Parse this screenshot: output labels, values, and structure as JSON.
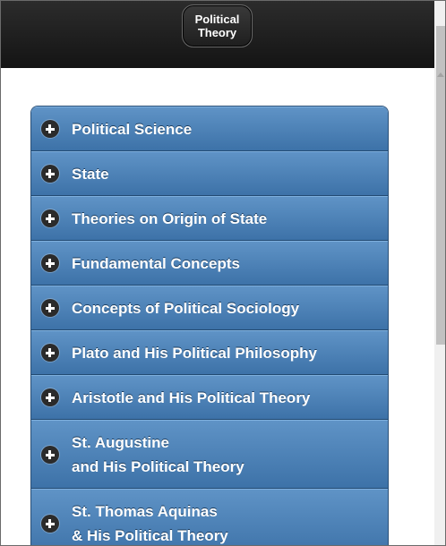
{
  "header": {
    "title_line1": "Political",
    "title_line2": "Theory"
  },
  "menu": {
    "items": [
      {
        "label": "Political Science"
      },
      {
        "label": "State"
      },
      {
        "label": "Theories on Origin of State"
      },
      {
        "label": "Fundamental Concepts"
      },
      {
        "label": "Concepts of Political Sociology"
      },
      {
        "label": "Plato and His Political Philosophy"
      },
      {
        "label": "Aristotle and His Political Theory"
      },
      {
        "line1": "St. Augustine",
        "line2": "and His Political Theory"
      },
      {
        "line1": "St. Thomas Aquinas",
        "line2": "& His Political Theory"
      }
    ]
  }
}
